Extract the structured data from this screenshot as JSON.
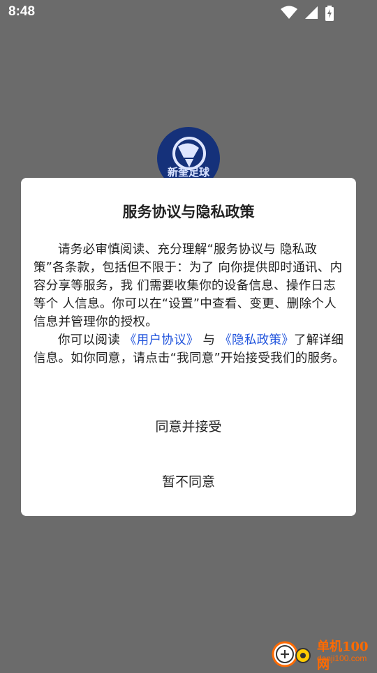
{
  "status": {
    "time": "8:48"
  },
  "app": {
    "logo_text": "新奎足球"
  },
  "dialog": {
    "title": "服务协议与隐私政策",
    "paragraph1": "请务必审慎阅读、充分理解“服务协议与 隐私政策”各条款，包括但不限于：为了 向你提供即时通讯、内容分享等服务，我 们需要收集你的设备信息、操作日志等个 人信息。你可以在“设置”中查看、变更、删除个人信息并管理你的授权。",
    "p2_prefix": "你可以阅读 ",
    "user_agreement_link": "《用户协议》",
    "p2_and": " 与 ",
    "privacy_policy_link": "《隐私政策》",
    "p2_suffix": "了解详细信息。如你同意，请点击“我同意”开始接受我们的服务。",
    "agree_label": "同意并接受",
    "disagree_label": "暂不同意"
  },
  "watermark": {
    "cn": "单机100网",
    "en": "danji100.com"
  },
  "colors": {
    "link": "#2255dd",
    "overlay": "#6b6b6b",
    "watermark": "#ff6a00"
  },
  "icons": [
    "wifi-icon",
    "cellular-signal-icon",
    "battery-charging-icon"
  ]
}
